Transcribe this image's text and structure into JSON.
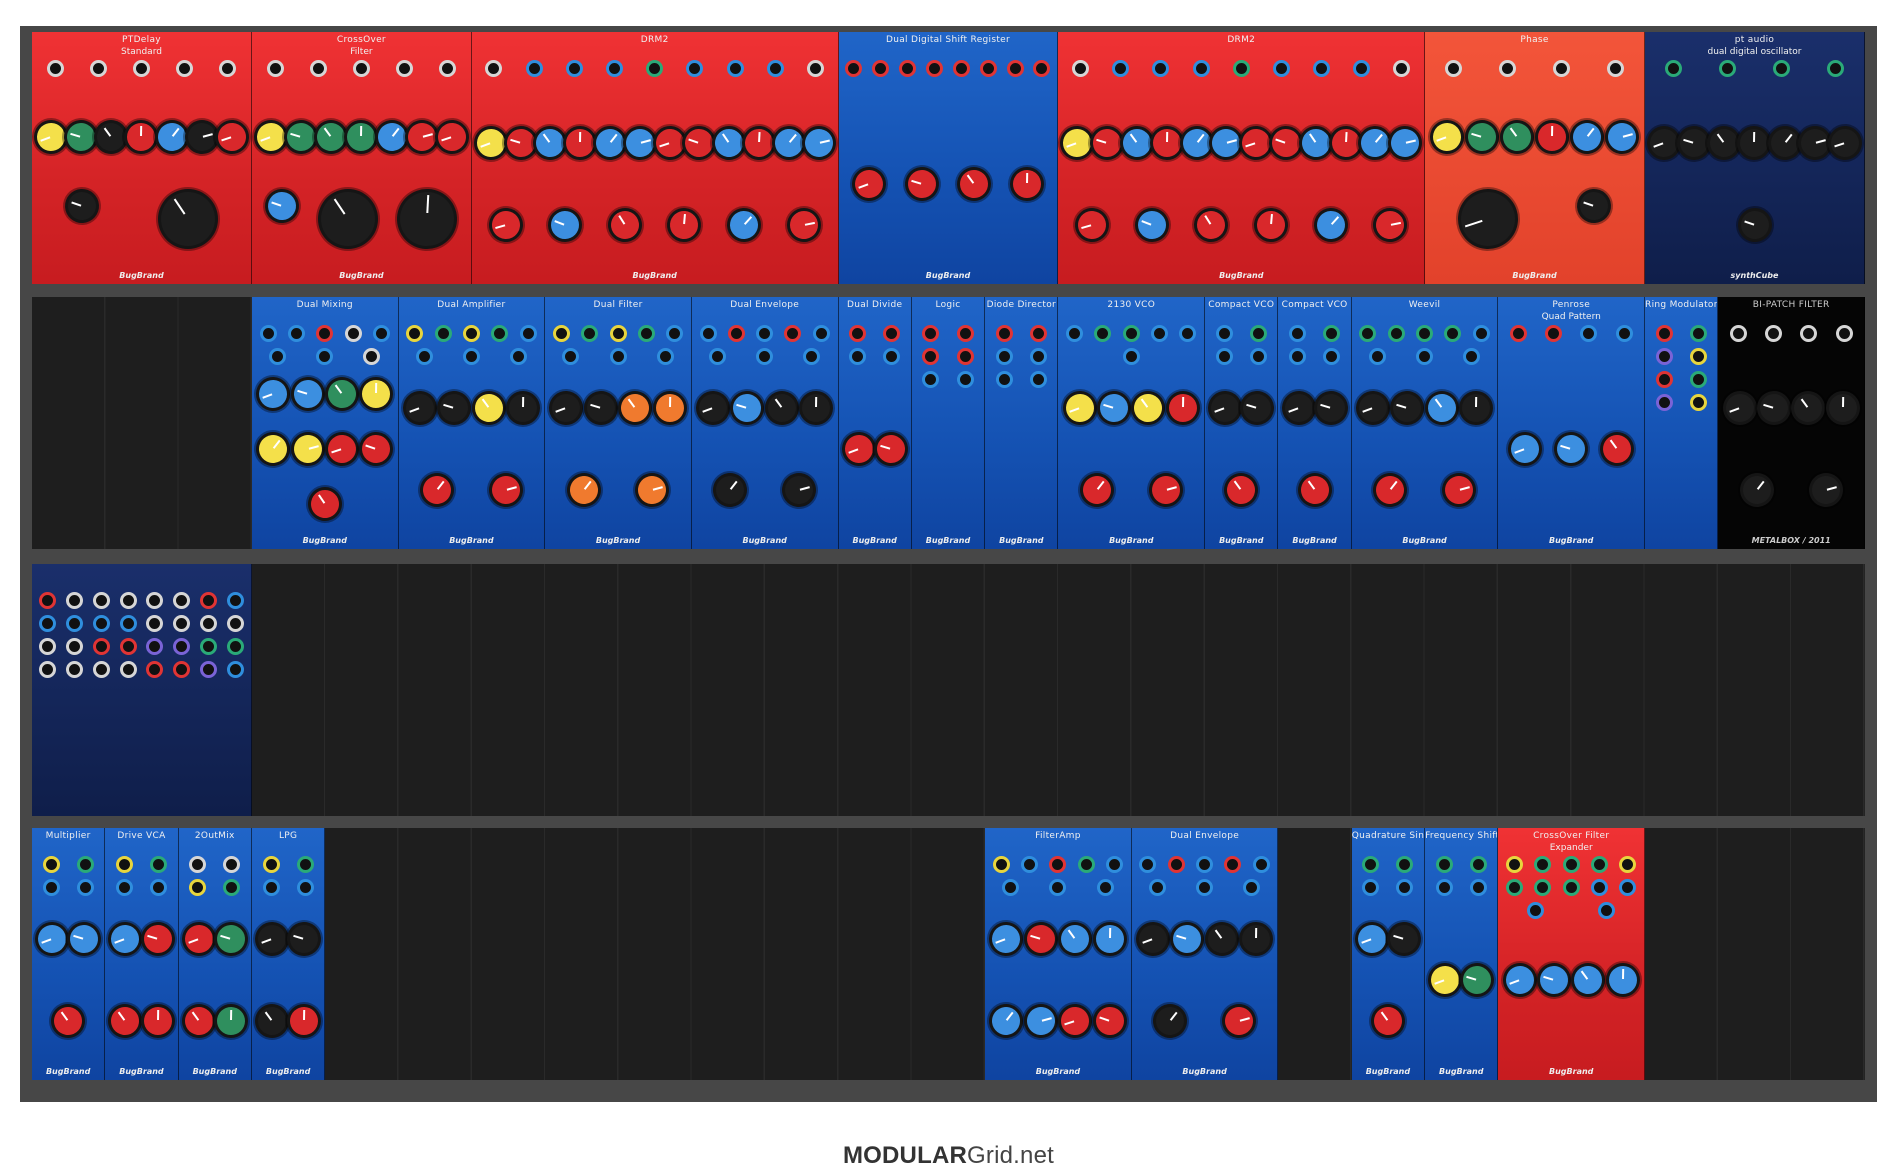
{
  "footer": {
    "brand_bold": "MODULAR",
    "brand_light": "Grid.net"
  },
  "rows": [
    {
      "id": "row-1",
      "modules": [
        {
          "title": "PTDelay",
          "sub": "Standard",
          "brand": "BugBrand",
          "hp": 3,
          "x": 0,
          "color": "red",
          "jacks": [
            "w",
            "w",
            "w",
            "w",
            "w"
          ],
          "knobs": [
            "y",
            "g",
            "d",
            "r",
            "b",
            "d",
            "r",
            "d",
            "big-d"
          ]
        },
        {
          "title": "CrossOver",
          "sub": "Filter",
          "brand": "BugBrand",
          "hp": 3,
          "x": 3,
          "color": "red",
          "jacks": [
            "w",
            "w",
            "w",
            "w",
            "w"
          ],
          "knobs": [
            "y",
            "g",
            "g",
            "g",
            "b",
            "r",
            "r",
            "b",
            "big-d",
            "big-d"
          ]
        },
        {
          "title": "DRM2",
          "sub": "",
          "brand": "BugBrand",
          "hp": 5,
          "x": 6,
          "color": "red",
          "jacks": [
            "w",
            "b",
            "b",
            "b",
            "g",
            "b",
            "b",
            "b",
            "w"
          ],
          "knobs": [
            "y",
            "r",
            "b",
            "r",
            "b",
            "b",
            "r",
            "r",
            "b",
            "r",
            "b",
            "b",
            "r",
            "b",
            "r",
            "r",
            "b",
            "r"
          ]
        },
        {
          "title": "Dual Digital Shift Register",
          "sub": "",
          "brand": "BugBrand",
          "hp": 3,
          "x": 11,
          "color": "blue",
          "jacks": [
            "r",
            "r",
            "r",
            "r",
            "r",
            "r",
            "r",
            "r"
          ],
          "knobs": [
            "r",
            "r",
            "r",
            "r"
          ]
        },
        {
          "title": "DRM2",
          "sub": "",
          "brand": "BugBrand",
          "hp": 5,
          "x": 14,
          "color": "red",
          "jacks": [
            "w",
            "b",
            "b",
            "b",
            "g",
            "b",
            "b",
            "b",
            "w"
          ],
          "knobs": [
            "y",
            "r",
            "b",
            "r",
            "b",
            "b",
            "r",
            "r",
            "b",
            "r",
            "b",
            "b",
            "r",
            "b",
            "r",
            "r",
            "b",
            "r"
          ]
        },
        {
          "title": "Phase",
          "sub": "",
          "brand": "BugBrand",
          "hp": 3,
          "x": 19,
          "color": "orange",
          "jacks": [
            "w",
            "w",
            "w",
            "w"
          ],
          "knobs": [
            "y",
            "g",
            "g",
            "r",
            "b",
            "b",
            "big-d",
            "d"
          ]
        },
        {
          "title": "pt audio",
          "sub": "dual digital oscillator",
          "brand": "synthCube",
          "hp": 3,
          "x": 22,
          "color": "navy",
          "jacks": [
            "g",
            "g",
            "g",
            "g"
          ],
          "knobs": [
            "d",
            "d",
            "d",
            "d",
            "d",
            "d",
            "d",
            "d"
          ]
        }
      ]
    },
    {
      "id": "row-2",
      "modules": [
        {
          "title": "Dual Mixing",
          "sub": "",
          "brand": "BugBrand",
          "hp": 2,
          "x": 3,
          "color": "blue",
          "jacks": [
            "b",
            "b",
            "r",
            "w",
            "b",
            "b",
            "b",
            "w"
          ],
          "knobs": [
            "b",
            "b",
            "g",
            "y",
            "y",
            "y",
            "r",
            "r",
            "r"
          ]
        },
        {
          "title": "Dual Amplifier",
          "sub": "",
          "brand": "BugBrand",
          "hp": 2,
          "x": 5,
          "color": "blue",
          "jacks": [
            "y",
            "g",
            "y",
            "g",
            "b",
            "b",
            "b",
            "b"
          ],
          "knobs": [
            "d",
            "d",
            "y",
            "d",
            "r",
            "r"
          ]
        },
        {
          "title": "Dual Filter",
          "sub": "",
          "brand": "BugBrand",
          "hp": 2,
          "x": 7,
          "color": "blue",
          "jacks": [
            "y",
            "g",
            "y",
            "g",
            "b",
            "b",
            "b",
            "b"
          ],
          "knobs": [
            "d",
            "d",
            "o",
            "o",
            "o",
            "o"
          ]
        },
        {
          "title": "Dual Envelope",
          "sub": "",
          "brand": "BugBrand",
          "hp": 2,
          "x": 9,
          "color": "blue",
          "jacks": [
            "b",
            "r",
            "b",
            "r",
            "b",
            "b",
            "b",
            "b"
          ],
          "knobs": [
            "d",
            "b",
            "d",
            "d",
            "d",
            "d"
          ]
        },
        {
          "title": "Dual Divide",
          "sub": "",
          "brand": "BugBrand",
          "hp": 1,
          "x": 11,
          "color": "blue",
          "jacks": [
            "r",
            "r",
            "b",
            "b"
          ],
          "knobs": [
            "r",
            "r"
          ]
        },
        {
          "title": "Logic",
          "sub": "",
          "brand": "BugBrand",
          "hp": 1,
          "x": 12,
          "color": "blue",
          "jacks": [
            "r",
            "r",
            "r",
            "r",
            "b",
            "b"
          ],
          "knobs": []
        },
        {
          "title": "Diode Director",
          "sub": "",
          "brand": "BugBrand",
          "hp": 1,
          "x": 13,
          "color": "blue",
          "jacks": [
            "r",
            "r",
            "b",
            "b",
            "b",
            "b"
          ],
          "knobs": []
        },
        {
          "title": "2130 VCO",
          "sub": "",
          "brand": "BugBrand",
          "hp": 2,
          "x": 14,
          "color": "blue",
          "jacks": [
            "b",
            "g",
            "g",
            "b",
            "b",
            "b"
          ],
          "knobs": [
            "y",
            "b",
            "y",
            "r",
            "r",
            "r"
          ]
        },
        {
          "title": "Compact VCO",
          "sub": "",
          "brand": "BugBrand",
          "hp": 1,
          "x": 16,
          "color": "blue",
          "jacks": [
            "b",
            "g",
            "b",
            "b"
          ],
          "knobs": [
            "d",
            "d",
            "r"
          ]
        },
        {
          "title": "Compact VCO",
          "sub": "",
          "brand": "BugBrand",
          "hp": 1,
          "x": 17,
          "color": "blue",
          "jacks": [
            "b",
            "g",
            "b",
            "b"
          ],
          "knobs": [
            "d",
            "d",
            "r"
          ]
        },
        {
          "title": "Weevil",
          "sub": "",
          "brand": "BugBrand",
          "hp": 2,
          "x": 18,
          "color": "blue",
          "jacks": [
            "g",
            "g",
            "g",
            "g",
            "b",
            "b",
            "b",
            "b"
          ],
          "knobs": [
            "d",
            "d",
            "b",
            "d",
            "r",
            "r"
          ]
        },
        {
          "title": "Penrose",
          "sub": "Quad Pattern",
          "brand": "BugBrand",
          "hp": 2,
          "x": 20,
          "color": "blue",
          "jacks": [
            "r",
            "r",
            "b",
            "b"
          ],
          "knobs": [
            "b",
            "b",
            "r"
          ]
        },
        {
          "title": "Ring Modulators",
          "sub": "",
          "brand": "",
          "hp": 1,
          "x": 22,
          "color": "blue",
          "jacks": [
            "r",
            "g",
            "p",
            "y",
            "r",
            "g",
            "p",
            "y"
          ],
          "knobs": []
        },
        {
          "title": "BI-PATCH FILTER",
          "sub": "",
          "brand": "METALBOX / 2011",
          "hp": 2,
          "x": 23,
          "color": "black",
          "jacks": [
            "w",
            "w",
            "w",
            "w"
          ],
          "knobs": [
            "d",
            "d",
            "d",
            "d",
            "d",
            "d"
          ]
        }
      ]
    },
    {
      "id": "row-3",
      "modules": [
        {
          "title": "",
          "sub": "",
          "brand": "",
          "hp": 3,
          "x": 0,
          "color": "navy",
          "jacks": [
            "r",
            "w",
            "w",
            "w",
            "w",
            "w",
            "r",
            "b",
            "b",
            "b",
            "b",
            "b",
            "w",
            "w",
            "w",
            "w",
            "w",
            "w",
            "r",
            "r",
            "p",
            "p",
            "g",
            "g",
            "w",
            "w",
            "w",
            "w",
            "r",
            "r",
            "p",
            "b"
          ],
          "knobs": []
        }
      ]
    },
    {
      "id": "row-4",
      "modules": [
        {
          "title": "Multiplier",
          "sub": "",
          "brand": "BugBrand",
          "hp": 1,
          "x": 0,
          "color": "blue",
          "jacks": [
            "y",
            "g",
            "b",
            "b"
          ],
          "knobs": [
            "b",
            "b",
            "r"
          ]
        },
        {
          "title": "Drive VCA",
          "sub": "",
          "brand": "BugBrand",
          "hp": 1,
          "x": 1,
          "color": "blue",
          "jacks": [
            "y",
            "g",
            "b",
            "b"
          ],
          "knobs": [
            "b",
            "r",
            "r",
            "r"
          ]
        },
        {
          "title": "2OutMix",
          "sub": "",
          "brand": "BugBrand",
          "hp": 1,
          "x": 2,
          "color": "blue",
          "jacks": [
            "w",
            "w",
            "y",
            "g"
          ],
          "knobs": [
            "r",
            "g",
            "r",
            "g"
          ]
        },
        {
          "title": "LPG",
          "sub": "",
          "brand": "BugBrand",
          "hp": 1,
          "x": 3,
          "color": "blue",
          "jacks": [
            "y",
            "g",
            "b",
            "b"
          ],
          "knobs": [
            "d",
            "d",
            "d",
            "r"
          ]
        },
        {
          "title": "FilterAmp",
          "sub": "",
          "brand": "BugBrand",
          "hp": 2,
          "x": 13,
          "color": "blue",
          "jacks": [
            "y",
            "b",
            "r",
            "g",
            "b",
            "b",
            "b",
            "b"
          ],
          "knobs": [
            "b",
            "r",
            "b",
            "b",
            "b",
            "b",
            "r",
            "r"
          ]
        },
        {
          "title": "Dual Envelope",
          "sub": "",
          "brand": "BugBrand",
          "hp": 2,
          "x": 15,
          "color": "blue",
          "jacks": [
            "b",
            "r",
            "b",
            "r",
            "b",
            "b",
            "b",
            "b"
          ],
          "knobs": [
            "d",
            "b",
            "d",
            "d",
            "d",
            "r"
          ]
        },
        {
          "title": "Quadrature Sine",
          "sub": "",
          "brand": "BugBrand",
          "hp": 1,
          "x": 18,
          "color": "blue",
          "jacks": [
            "g",
            "g",
            "b",
            "b"
          ],
          "knobs": [
            "b",
            "d",
            "r"
          ]
        },
        {
          "title": "Frequency Shifter",
          "sub": "",
          "brand": "BugBrand",
          "hp": 1,
          "x": 19,
          "color": "blue",
          "jacks": [
            "g",
            "g",
            "b",
            "b"
          ],
          "knobs": [
            "y",
            "g"
          ]
        },
        {
          "title": "CrossOver Filter",
          "sub": "Expander",
          "brand": "BugBrand",
          "hp": 2,
          "x": 20,
          "color": "red",
          "jacks": [
            "y",
            "g",
            "g",
            "g",
            "y",
            "g",
            "g",
            "g",
            "b",
            "b",
            "b",
            "b"
          ],
          "knobs": [
            "b",
            "b",
            "b",
            "b"
          ]
        }
      ]
    }
  ]
}
